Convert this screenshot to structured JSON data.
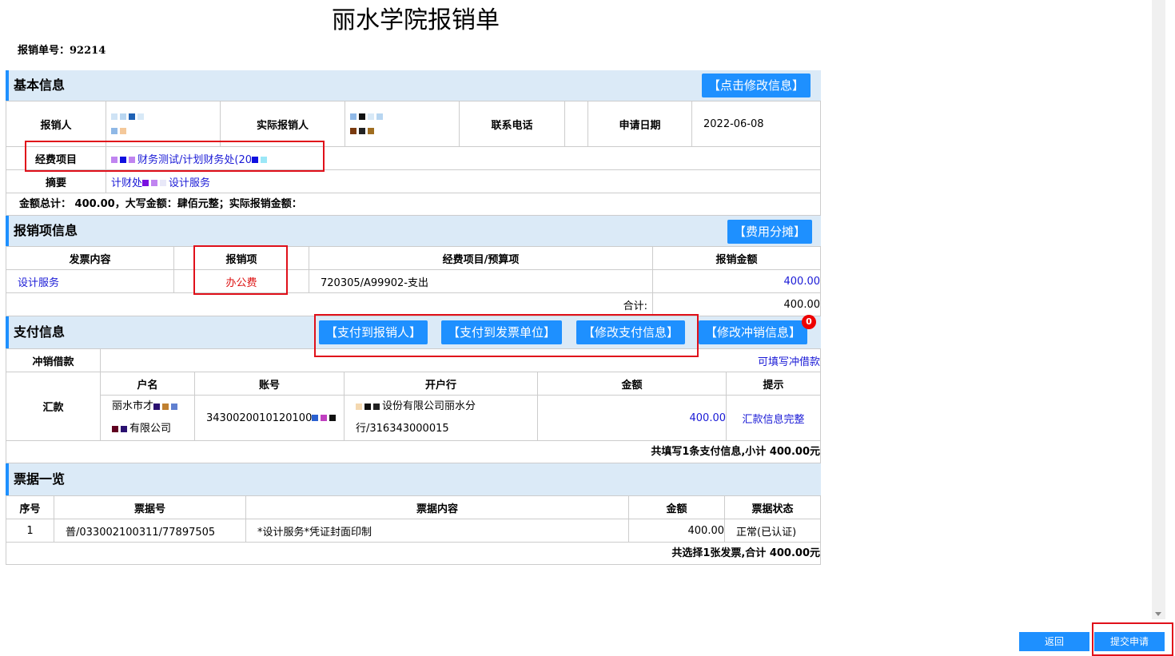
{
  "page": {
    "title": "丽水学院报销单",
    "doc_no_label": "报销单号：",
    "doc_no": "92214"
  },
  "basic": {
    "header": "基本信息",
    "edit_btn": "【点击修改信息】",
    "applicant_label": "报销人",
    "actual_label": "实际报销人",
    "phone_label": "联系电话",
    "date_label": "申请日期",
    "date_value": "2022-06-08",
    "project_label": "经费项目",
    "project_value": "财务测试/计划财务处(20",
    "summary_label": "摘要",
    "summary_a": "计财处",
    "summary_b": "设计服务",
    "total_text": "金额总计：  400.00，大写金额：肆佰元整；实际报销金额："
  },
  "items": {
    "header": "报销项信息",
    "split_btn": "【费用分摊】",
    "col_content": "发票内容",
    "col_item": "报销项",
    "col_budget": "经费项目/预算项",
    "col_amount": "报销金额",
    "row_content": "设计服务",
    "row_item": "办公费",
    "row_budget": "720305/A99902-支出",
    "row_amount": "400.00",
    "sum_label": "合计:",
    "sum_value": "400.00"
  },
  "payment": {
    "header": "支付信息",
    "btn_pay_applicant": "【支付到报销人】",
    "btn_pay_invoice": "【支付到发票单位】",
    "btn_edit_pay": "【修改支付信息】",
    "btn_edit_offset": "【修改冲销信息】",
    "badge": "0",
    "offset_label": "冲销借款",
    "offset_link": "可填写冲借款",
    "remit_label": "汇款",
    "col_name": "户名",
    "col_account": "账号",
    "col_bank": "开户行",
    "col_amount": "金额",
    "col_tip": "提示",
    "name_a": "丽水市才",
    "name_b": "有限公司",
    "account": "3430020010120100",
    "bank_a": "设份有限公司丽水分",
    "bank_b": "行/316343000015",
    "amount": "400.00",
    "tip": "汇款信息完整",
    "summary": "共填写1条支付信息,小计 400.00元"
  },
  "invoices": {
    "header": "票据一览",
    "col_no": "序号",
    "col_code": "票据号",
    "col_content": "票据内容",
    "col_amount": "金额",
    "col_status": "票据状态",
    "row_no": "1",
    "row_code": "普/033002100311/77897505",
    "row_content": "*设计服务*凭证封面印制",
    "row_amount": "400.00",
    "row_status": "正常(已认证)",
    "summary": "共选择1张发票,合计 400.00元"
  },
  "footer": {
    "back": "返回",
    "submit": "提交申请"
  },
  "colors": {
    "accent": "#1e90ff",
    "header_bg": "#dbeaf7",
    "highlight": "#e0101a",
    "link": "#1a1ad6"
  }
}
